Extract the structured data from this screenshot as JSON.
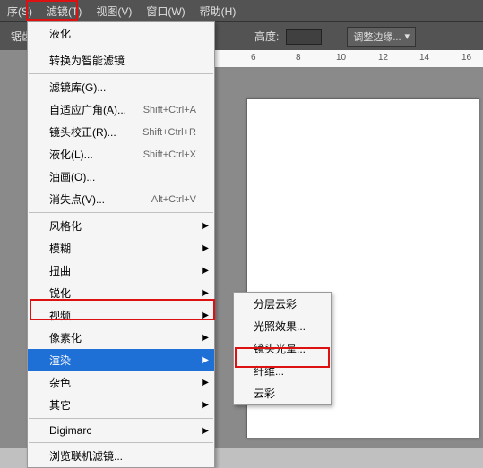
{
  "menubar": {
    "items": [
      "序(S)",
      "滤镜(T)",
      "视图(V)",
      "窗口(W)",
      "帮助(H)"
    ]
  },
  "toolbar": {
    "partial_label": "锯齿",
    "height_label": "高度:",
    "refine_label": "调整边缘...",
    "arrow": "▾"
  },
  "ruler": {
    "ticks": [
      "6",
      "8",
      "10",
      "12",
      "14",
      "16"
    ]
  },
  "filter_menu": {
    "last": "液化",
    "convert": "转换为智能滤镜",
    "gallery": "滤镜库(G)...",
    "wide": {
      "label": "自适应广角(A)...",
      "shortcut": "Shift+Ctrl+A"
    },
    "lens": {
      "label": "镜头校正(R)...",
      "shortcut": "Shift+Ctrl+R"
    },
    "liquify": {
      "label": "液化(L)...",
      "shortcut": "Shift+Ctrl+X"
    },
    "oil": "油画(O)...",
    "vanish": {
      "label": "消失点(V)...",
      "shortcut": "Alt+Ctrl+V"
    },
    "groups": [
      "风格化",
      "模糊",
      "扭曲",
      "锐化",
      "视频",
      "像素化",
      "渲染",
      "杂色",
      "其它"
    ],
    "digimarc": "Digimarc",
    "browse": "浏览联机滤镜..."
  },
  "render_submenu": {
    "items": [
      "分层云彩",
      "光照效果...",
      "镜头光晕...",
      "纤维...",
      "云彩"
    ]
  }
}
